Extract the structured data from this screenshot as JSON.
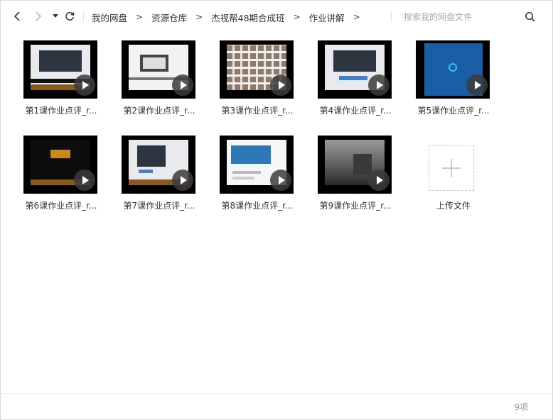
{
  "toolbar": {
    "breadcrumbs": [
      "我的网盘",
      "资源仓库",
      "杰视帮48期合成班",
      "作业讲解"
    ],
    "separator": ">",
    "search_placeholder": "搜索我的网盘文件"
  },
  "files": [
    {
      "name": "第1课作业点评_r...",
      "type": "video"
    },
    {
      "name": "第2课作业点评_r...",
      "type": "video"
    },
    {
      "name": "第3课作业点评_r...",
      "type": "video"
    },
    {
      "name": "第4课作业点评_r...",
      "type": "video"
    },
    {
      "name": "第5课作业点评_r...",
      "type": "video"
    },
    {
      "name": "第6课作业点评_r...",
      "type": "video"
    },
    {
      "name": "第7课作业点评_r...",
      "type": "video"
    },
    {
      "name": "第8课作业点评_r...",
      "type": "video"
    },
    {
      "name": "第9课作业点评_r...",
      "type": "video"
    }
  ],
  "upload": {
    "label": "上传文件"
  },
  "footer": {
    "count": "9项"
  },
  "colors": {
    "accent": "#1a5ea8",
    "text": "#333333",
    "muted": "#999999"
  }
}
